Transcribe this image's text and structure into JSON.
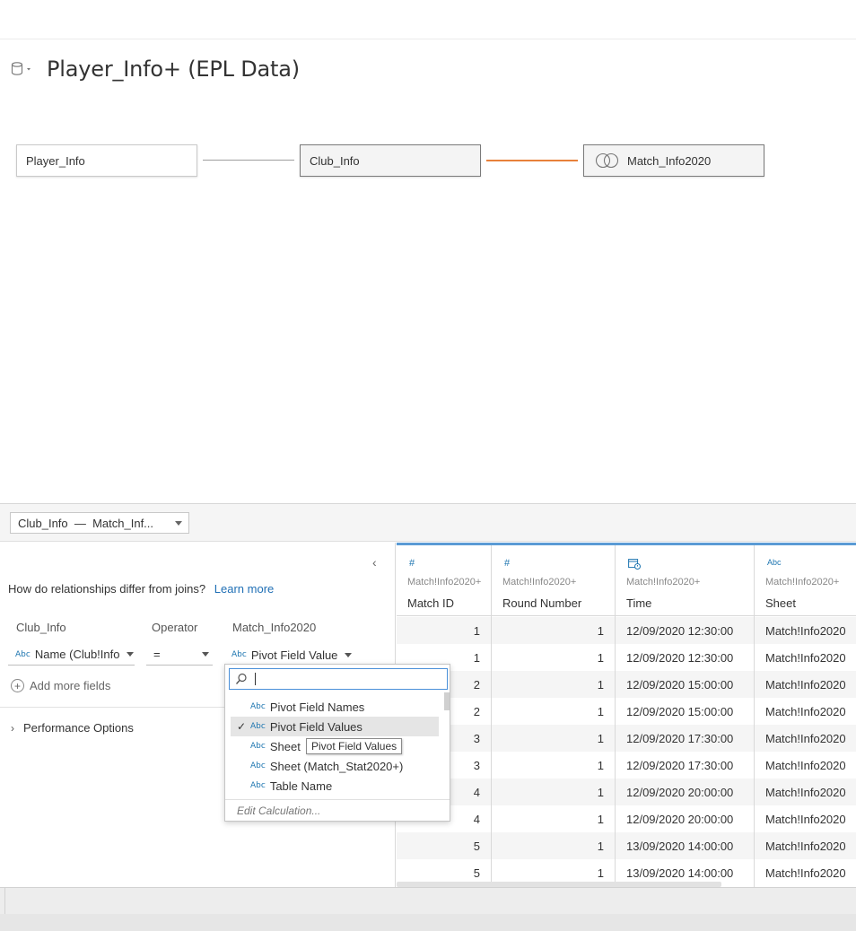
{
  "datasource": {
    "title": "Player_Info+ (EPL Data)",
    "icon": "database-icon"
  },
  "nodes": [
    {
      "label": "Player_Info"
    },
    {
      "label": "Club_Info"
    },
    {
      "label": "Match_Info2020",
      "icon": "union-circles-icon"
    }
  ],
  "colors": {
    "accent": "#5b9bd5",
    "relationship_line": "#e8813a",
    "link": "#1f6fb5",
    "abc_icon": "#1d75b0"
  },
  "relationship_select": {
    "value": "Club_Info  —  Match_Inf..."
  },
  "relationship_panel": {
    "question": "How do relationships differ from joins?",
    "learn_more": "Learn more",
    "headers": {
      "left": "Club_Info",
      "operator": "Operator",
      "right": "Match_Info2020"
    },
    "left_field": "Name (Club!Info",
    "operator": "=",
    "right_field": "Pivot Field Value",
    "type_abc": "Abc",
    "add_fields": "Add more fields",
    "performance": "Performance Options"
  },
  "dropdown": {
    "search_value": "",
    "items": [
      {
        "type": "Abc",
        "label": "Pivot Field Names",
        "selected": false
      },
      {
        "type": "Abc",
        "label": "Pivot Field Values",
        "selected": true,
        "check": "✓"
      },
      {
        "type": "Abc",
        "label": "Sheet",
        "selected": false
      },
      {
        "type": "Abc",
        "label": "Sheet (Match_Stat2020+)",
        "selected": false
      },
      {
        "type": "Abc",
        "label": "Table Name",
        "selected": false
      }
    ],
    "edit": "Edit Calculation...",
    "tooltip": "Pivot Field Values"
  },
  "grid": {
    "columns": [
      {
        "type": "#",
        "source": "Match!Info2020+",
        "name": "Match ID"
      },
      {
        "type": "#",
        "source": "Match!Info2020+",
        "name": "Round Number"
      },
      {
        "type": "date-time-icon",
        "source": "Match!Info2020+",
        "name": "Time"
      },
      {
        "type": "Abc",
        "source": "Match!Info2020+",
        "name": "Sheet"
      }
    ],
    "rows": [
      [
        "1",
        "1",
        "12/09/2020 12:30:00",
        "Match!Info2020"
      ],
      [
        "1",
        "1",
        "12/09/2020 12:30:00",
        "Match!Info2020"
      ],
      [
        "2",
        "1",
        "12/09/2020 15:00:00",
        "Match!Info2020"
      ],
      [
        "2",
        "1",
        "12/09/2020 15:00:00",
        "Match!Info2020"
      ],
      [
        "3",
        "1",
        "12/09/2020 17:30:00",
        "Match!Info2020"
      ],
      [
        "3",
        "1",
        "12/09/2020 17:30:00",
        "Match!Info2020"
      ],
      [
        "4",
        "1",
        "12/09/2020 20:00:00",
        "Match!Info2020"
      ],
      [
        "4",
        "1",
        "12/09/2020 20:00:00",
        "Match!Info2020"
      ],
      [
        "5",
        "1",
        "13/09/2020 14:00:00",
        "Match!Info2020"
      ],
      [
        "5",
        "1",
        "13/09/2020 14:00:00",
        "Match!Info2020"
      ]
    ]
  }
}
